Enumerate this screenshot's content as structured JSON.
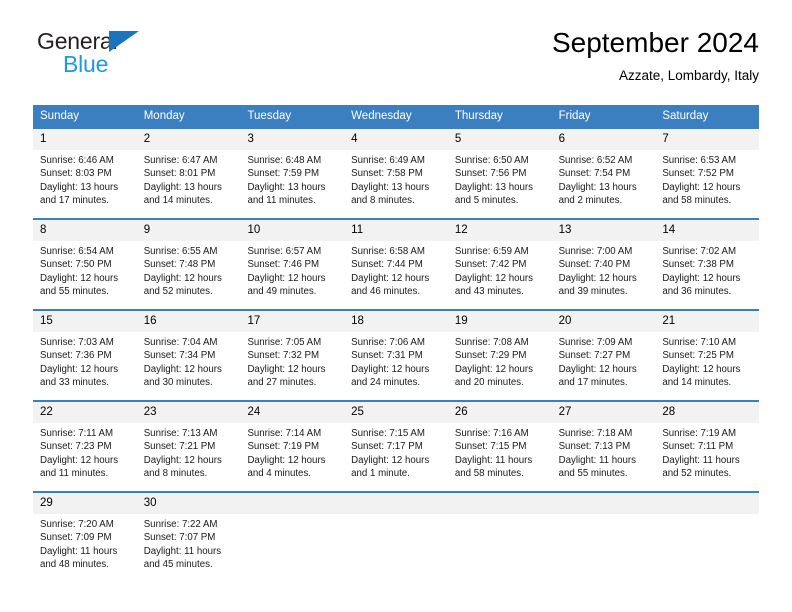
{
  "brand": {
    "name_dark": "General",
    "name_blue": "Blue",
    "accent_blue": "#1b75bb",
    "light_blue": "#1b9ae0"
  },
  "header": {
    "title": "September 2024",
    "location": "Azzate, Lombardy, Italy"
  },
  "theme": {
    "header_bar": "#3c7fc1",
    "day_number_bg": "#f2f2f2",
    "text": "#000000"
  },
  "weekdays": [
    "Sunday",
    "Monday",
    "Tuesday",
    "Wednesday",
    "Thursday",
    "Friday",
    "Saturday"
  ],
  "weeks": [
    [
      {
        "day": "1",
        "sunrise": "Sunrise: 6:46 AM",
        "sunset": "Sunset: 8:03 PM",
        "daylight1": "Daylight: 13 hours",
        "daylight2": "and 17 minutes."
      },
      {
        "day": "2",
        "sunrise": "Sunrise: 6:47 AM",
        "sunset": "Sunset: 8:01 PM",
        "daylight1": "Daylight: 13 hours",
        "daylight2": "and 14 minutes."
      },
      {
        "day": "3",
        "sunrise": "Sunrise: 6:48 AM",
        "sunset": "Sunset: 7:59 PM",
        "daylight1": "Daylight: 13 hours",
        "daylight2": "and 11 minutes."
      },
      {
        "day": "4",
        "sunrise": "Sunrise: 6:49 AM",
        "sunset": "Sunset: 7:58 PM",
        "daylight1": "Daylight: 13 hours",
        "daylight2": "and 8 minutes."
      },
      {
        "day": "5",
        "sunrise": "Sunrise: 6:50 AM",
        "sunset": "Sunset: 7:56 PM",
        "daylight1": "Daylight: 13 hours",
        "daylight2": "and 5 minutes."
      },
      {
        "day": "6",
        "sunrise": "Sunrise: 6:52 AM",
        "sunset": "Sunset: 7:54 PM",
        "daylight1": "Daylight: 13 hours",
        "daylight2": "and 2 minutes."
      },
      {
        "day": "7",
        "sunrise": "Sunrise: 6:53 AM",
        "sunset": "Sunset: 7:52 PM",
        "daylight1": "Daylight: 12 hours",
        "daylight2": "and 58 minutes."
      }
    ],
    [
      {
        "day": "8",
        "sunrise": "Sunrise: 6:54 AM",
        "sunset": "Sunset: 7:50 PM",
        "daylight1": "Daylight: 12 hours",
        "daylight2": "and 55 minutes."
      },
      {
        "day": "9",
        "sunrise": "Sunrise: 6:55 AM",
        "sunset": "Sunset: 7:48 PM",
        "daylight1": "Daylight: 12 hours",
        "daylight2": "and 52 minutes."
      },
      {
        "day": "10",
        "sunrise": "Sunrise: 6:57 AM",
        "sunset": "Sunset: 7:46 PM",
        "daylight1": "Daylight: 12 hours",
        "daylight2": "and 49 minutes."
      },
      {
        "day": "11",
        "sunrise": "Sunrise: 6:58 AM",
        "sunset": "Sunset: 7:44 PM",
        "daylight1": "Daylight: 12 hours",
        "daylight2": "and 46 minutes."
      },
      {
        "day": "12",
        "sunrise": "Sunrise: 6:59 AM",
        "sunset": "Sunset: 7:42 PM",
        "daylight1": "Daylight: 12 hours",
        "daylight2": "and 43 minutes."
      },
      {
        "day": "13",
        "sunrise": "Sunrise: 7:00 AM",
        "sunset": "Sunset: 7:40 PM",
        "daylight1": "Daylight: 12 hours",
        "daylight2": "and 39 minutes."
      },
      {
        "day": "14",
        "sunrise": "Sunrise: 7:02 AM",
        "sunset": "Sunset: 7:38 PM",
        "daylight1": "Daylight: 12 hours",
        "daylight2": "and 36 minutes."
      }
    ],
    [
      {
        "day": "15",
        "sunrise": "Sunrise: 7:03 AM",
        "sunset": "Sunset: 7:36 PM",
        "daylight1": "Daylight: 12 hours",
        "daylight2": "and 33 minutes."
      },
      {
        "day": "16",
        "sunrise": "Sunrise: 7:04 AM",
        "sunset": "Sunset: 7:34 PM",
        "daylight1": "Daylight: 12 hours",
        "daylight2": "and 30 minutes."
      },
      {
        "day": "17",
        "sunrise": "Sunrise: 7:05 AM",
        "sunset": "Sunset: 7:32 PM",
        "daylight1": "Daylight: 12 hours",
        "daylight2": "and 27 minutes."
      },
      {
        "day": "18",
        "sunrise": "Sunrise: 7:06 AM",
        "sunset": "Sunset: 7:31 PM",
        "daylight1": "Daylight: 12 hours",
        "daylight2": "and 24 minutes."
      },
      {
        "day": "19",
        "sunrise": "Sunrise: 7:08 AM",
        "sunset": "Sunset: 7:29 PM",
        "daylight1": "Daylight: 12 hours",
        "daylight2": "and 20 minutes."
      },
      {
        "day": "20",
        "sunrise": "Sunrise: 7:09 AM",
        "sunset": "Sunset: 7:27 PM",
        "daylight1": "Daylight: 12 hours",
        "daylight2": "and 17 minutes."
      },
      {
        "day": "21",
        "sunrise": "Sunrise: 7:10 AM",
        "sunset": "Sunset: 7:25 PM",
        "daylight1": "Daylight: 12 hours",
        "daylight2": "and 14 minutes."
      }
    ],
    [
      {
        "day": "22",
        "sunrise": "Sunrise: 7:11 AM",
        "sunset": "Sunset: 7:23 PM",
        "daylight1": "Daylight: 12 hours",
        "daylight2": "and 11 minutes."
      },
      {
        "day": "23",
        "sunrise": "Sunrise: 7:13 AM",
        "sunset": "Sunset: 7:21 PM",
        "daylight1": "Daylight: 12 hours",
        "daylight2": "and 8 minutes."
      },
      {
        "day": "24",
        "sunrise": "Sunrise: 7:14 AM",
        "sunset": "Sunset: 7:19 PM",
        "daylight1": "Daylight: 12 hours",
        "daylight2": "and 4 minutes."
      },
      {
        "day": "25",
        "sunrise": "Sunrise: 7:15 AM",
        "sunset": "Sunset: 7:17 PM",
        "daylight1": "Daylight: 12 hours",
        "daylight2": "and 1 minute."
      },
      {
        "day": "26",
        "sunrise": "Sunrise: 7:16 AM",
        "sunset": "Sunset: 7:15 PM",
        "daylight1": "Daylight: 11 hours",
        "daylight2": "and 58 minutes."
      },
      {
        "day": "27",
        "sunrise": "Sunrise: 7:18 AM",
        "sunset": "Sunset: 7:13 PM",
        "daylight1": "Daylight: 11 hours",
        "daylight2": "and 55 minutes."
      },
      {
        "day": "28",
        "sunrise": "Sunrise: 7:19 AM",
        "sunset": "Sunset: 7:11 PM",
        "daylight1": "Daylight: 11 hours",
        "daylight2": "and 52 minutes."
      }
    ],
    [
      {
        "day": "29",
        "sunrise": "Sunrise: 7:20 AM",
        "sunset": "Sunset: 7:09 PM",
        "daylight1": "Daylight: 11 hours",
        "daylight2": "and 48 minutes."
      },
      {
        "day": "30",
        "sunrise": "Sunrise: 7:22 AM",
        "sunset": "Sunset: 7:07 PM",
        "daylight1": "Daylight: 11 hours",
        "daylight2": "and 45 minutes."
      },
      {
        "day": "",
        "sunrise": "",
        "sunset": "",
        "daylight1": "",
        "daylight2": ""
      },
      {
        "day": "",
        "sunrise": "",
        "sunset": "",
        "daylight1": "",
        "daylight2": ""
      },
      {
        "day": "",
        "sunrise": "",
        "sunset": "",
        "daylight1": "",
        "daylight2": ""
      },
      {
        "day": "",
        "sunrise": "",
        "sunset": "",
        "daylight1": "",
        "daylight2": ""
      },
      {
        "day": "",
        "sunrise": "",
        "sunset": "",
        "daylight1": "",
        "daylight2": ""
      }
    ]
  ]
}
